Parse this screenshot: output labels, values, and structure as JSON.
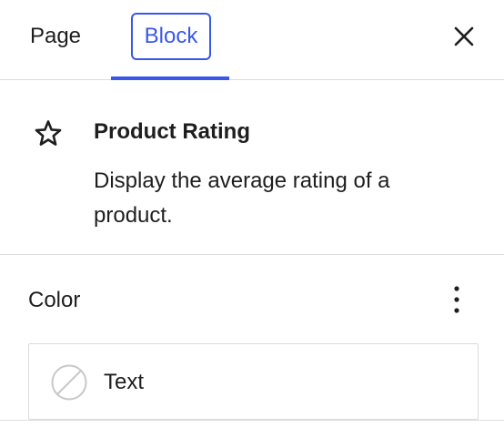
{
  "tabs": [
    {
      "label": "Page",
      "active": false
    },
    {
      "label": "Block",
      "active": true
    }
  ],
  "close_icon": "close-icon",
  "block": {
    "icon": "star-outline-icon",
    "title": "Product Rating",
    "description": "Display the average rating of a product."
  },
  "color_panel": {
    "title": "Color",
    "menu_icon": "more-vertical-icon",
    "items": [
      {
        "label": "Text",
        "icon": "no-color-swatch-icon"
      }
    ]
  },
  "colors": {
    "accent": "#3858e9",
    "text": "#1e1e1e",
    "border": "#dcdcde"
  }
}
